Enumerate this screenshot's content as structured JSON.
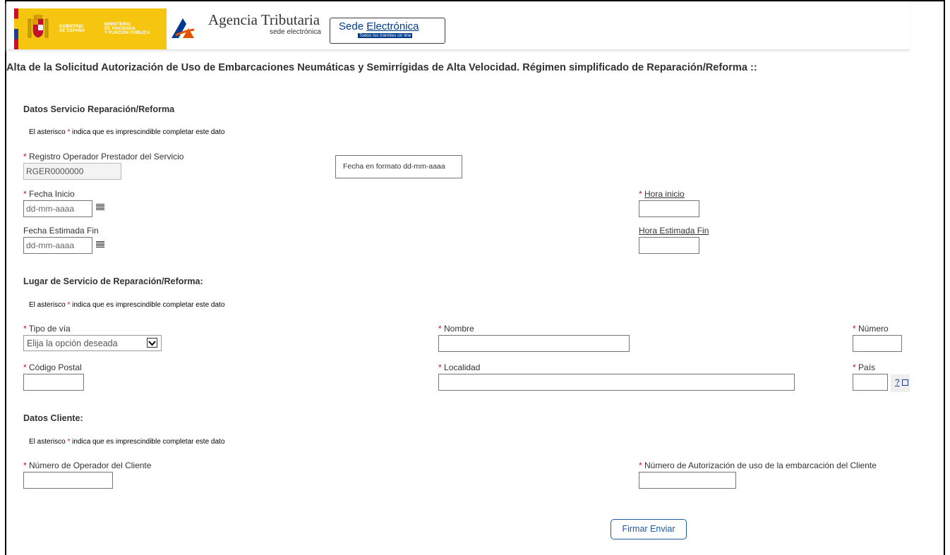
{
  "header": {
    "gobierno_text": [
      "GOBIERNO",
      "DE ESPAÑA"
    ],
    "ministerio_text": [
      "MINISTERIO",
      "DE HACIENDA",
      "Y FUNCIÓN PÚBLICA"
    ],
    "agency_name": "Agencia Tributaria",
    "agency_sub": "sede electrónica",
    "sede_main_1": "Sede ",
    "sede_main_2": "Electrónica",
    "sede_sub": "Todos los trámites on line"
  },
  "page_title": "Alta de la Solicitud Autorización de Uso de Embarcaciones Neumáticas y Semirrígidas de Alta Velocidad. Régimen simplificado de Reparación/Reforma ::",
  "required_mark": "*",
  "note": {
    "before": "El asterisco ",
    "after": " indica que es imprescindible completar este dato"
  },
  "servicio": {
    "title": "Datos Servicio Reparación/Reforma",
    "registro_label": "Registro Operador Prestador del Servicio",
    "registro_value": "RGER0000000",
    "tooltip": "Fecha en formato dd-mm-aaaa",
    "fecha_inicio_label": "Fecha Inicio",
    "fecha_inicio_placeholder": "dd-mm-aaaa",
    "hora_inicio_label": "Hora inicio",
    "fecha_fin_label": "Fecha Estimada Fin",
    "fecha_fin_placeholder": "dd-mm-aaaa",
    "hora_fin_label": "Hora Estimada Fin"
  },
  "lugar": {
    "title": "Lugar de Servicio de Reparación/Reforma:",
    "tipo_via_label": "Tipo de vía",
    "tipo_via_value": "Elija la opción deseada",
    "nombre_label": "Nombre",
    "numero_label": "Número",
    "cp_label": "Código Postal",
    "localidad_label": "Localidad",
    "pais_label": "País",
    "help_label": "?"
  },
  "cliente": {
    "title": "Datos Cliente:",
    "operador_label": "Número de Operador del Cliente",
    "autorizacion_label": "Número de Autorización de uso de la embarcación del Cliente"
  },
  "submit_label": "Firmar Enviar",
  "colors": {
    "required": "#e30613",
    "gobierno_yellow": "#f6c510",
    "brand_blue": "#003a8c"
  }
}
